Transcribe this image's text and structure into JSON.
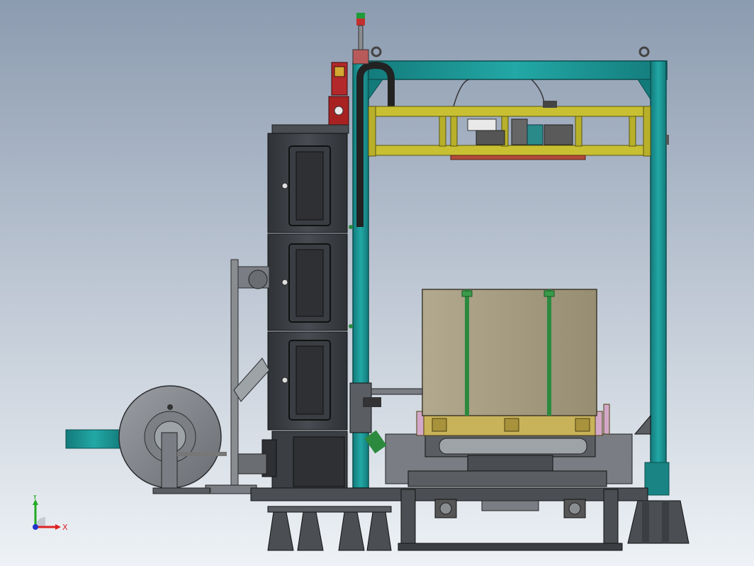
{
  "view": {
    "background_top": "#8c9bb0",
    "background_bottom": "#eef2f6"
  },
  "colors": {
    "frame_teal": "#1f9c9c",
    "yellow_frame": "#c8c032",
    "cabinet_dark": "#3c3f44",
    "cabinet_panel": "#4d5157",
    "box_tan": "#a39a80",
    "strap_green": "#2b8a3e",
    "motor_red": "#b32828",
    "steel_grey": "#7a7e84",
    "pallet_yellow": "#c9b35a"
  },
  "triad": {
    "x_label": "X",
    "y_label": "Y",
    "x_color": "#d22",
    "y_color": "#2a2",
    "z_color": "#23c"
  }
}
